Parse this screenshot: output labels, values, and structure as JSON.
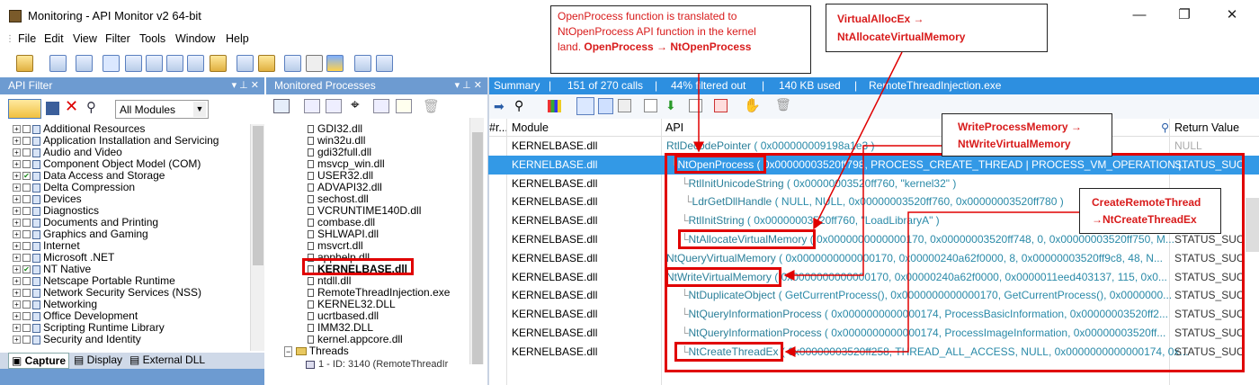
{
  "window": {
    "title": "Monitoring - API Monitor v2 64-bit",
    "minimize": "—",
    "maximize": "❐",
    "close": "✕"
  },
  "menu": [
    "File",
    "Edit",
    "View",
    "Filter",
    "Tools",
    "Window",
    "Help"
  ],
  "api_filter": {
    "title": "API Filter",
    "pins": "▾ ⊥ ✕",
    "module_select": "All Modules",
    "categories": [
      {
        "label": "Additional Resources",
        "checked": false
      },
      {
        "label": "Application Installation and Servicing",
        "checked": false
      },
      {
        "label": "Audio and Video",
        "checked": false
      },
      {
        "label": "Component Object Model (COM)",
        "checked": false
      },
      {
        "label": "Data Access and Storage",
        "checked": true
      },
      {
        "label": "Delta Compression",
        "checked": false
      },
      {
        "label": "Devices",
        "checked": false
      },
      {
        "label": "Diagnostics",
        "checked": false
      },
      {
        "label": "Documents and Printing",
        "checked": false
      },
      {
        "label": "Graphics and Gaming",
        "checked": false
      },
      {
        "label": "Internet",
        "checked": false
      },
      {
        "label": "Microsoft .NET",
        "checked": false
      },
      {
        "label": "NT Native",
        "checked": true
      },
      {
        "label": "Netscape Portable Runtime",
        "checked": false
      },
      {
        "label": "Network Security Services (NSS)",
        "checked": false
      },
      {
        "label": "Networking",
        "checked": false
      },
      {
        "label": "Office Development",
        "checked": false
      },
      {
        "label": "Scripting Runtime Library",
        "checked": false
      },
      {
        "label": "Security and Identity",
        "checked": false
      }
    ],
    "tabs": [
      "Capture",
      "Display",
      "External DLL"
    ]
  },
  "monitored_processes": {
    "title": "Monitored Processes",
    "pins": "▾ ⊥ ✕",
    "modules": [
      "GDI32.dll",
      "win32u.dll",
      "gdi32full.dll",
      "msvcp_win.dll",
      "USER32.dll",
      "ADVAPI32.dll",
      "sechost.dll",
      "VCRUNTIME140D.dll",
      "combase.dll",
      "SHLWAPI.dll",
      "msvcrt.dll",
      "apphelp.dll",
      "KERNELBASE.dll",
      "ntdll.dll",
      "RemoteThreadInjection.exe",
      "KERNEL32.DLL",
      "ucrtbased.dll",
      "IMM32.DLL",
      "kernel.appcore.dll"
    ],
    "threads_label": "Threads",
    "thread_item": "1 - ID: 3140 (RemoteThreadIr"
  },
  "summary": {
    "label": "Summary",
    "calls": "151 of 270 calls",
    "filtered": "44% filtered out",
    "used": "140 KB used",
    "process": "RemoteThreadInjection.exe"
  },
  "grid": {
    "headers": {
      "num": "#r...",
      "module": "Module",
      "api": "API",
      "ret": "Return Value"
    },
    "rows": [
      {
        "module": "KERNELBASE.dll",
        "fn": "RtlDecodePointer",
        "args": " ( 0x000000009198a1e3 )",
        "ret": "NULL"
      },
      {
        "module": "KERNELBASE.dll",
        "fn": "NtOpenProcess",
        "args": " ( 0x00000003520ff798, PROCESS_CREATE_THREAD | PROCESS_VM_OPERATION |...",
        "ret": "STATUS_SUC",
        "selected": true
      },
      {
        "module": "KERNELBASE.dll",
        "fn": "RtlInitUnicodeString",
        "args": " ( 0x00000003520ff760, \"kernel32\" )",
        "ret": ""
      },
      {
        "module": "KERNELBASE.dll",
        "fn": "LdrGetDllHandle",
        "args": " ( NULL, NULL, 0x00000003520ff760, 0x00000003520ff780 )",
        "ret": ""
      },
      {
        "module": "KERNELBASE.dll",
        "fn": "RtlInitString",
        "args": " ( 0x00000003520ff760, \"LoadLibraryA\" )",
        "ret": ""
      },
      {
        "module": "KERNELBASE.dll",
        "fn": "NtAllocateVirtualMemory",
        "args": " ( 0x0000000000000170, 0x00000003520ff748, 0, 0x00000003520ff750, M...",
        "ret": "STATUS_SUC"
      },
      {
        "module": "KERNELBASE.dll",
        "fn": "NtQueryVirtualMemory",
        "args": " ( 0x0000000000000170, 0x00000240a62f0000, 8, 0x00000003520ff9c8, 48, N...",
        "ret": "STATUS_SUC"
      },
      {
        "module": "KERNELBASE.dll",
        "fn": "NtWriteVirtualMemory",
        "args": " ( 0x0000000000000170, 0x00000240a62f0000, 0x0000011eed403137, 115, 0x0...",
        "ret": "STATUS_SUC"
      },
      {
        "module": "KERNELBASE.dll",
        "fn": "NtDuplicateObject",
        "args": " ( GetCurrentProcess(), 0x0000000000000170, GetCurrentProcess(), 0x0000000...",
        "ret": "STATUS_SUC"
      },
      {
        "module": "KERNELBASE.dll",
        "fn": "NtQueryInformationProcess",
        "args": " ( 0x0000000000000174, ProcessBasicInformation, 0x00000003520ff2...",
        "ret": "STATUS_SUC"
      },
      {
        "module": "KERNELBASE.dll",
        "fn": "NtQueryInformationProcess",
        "args": " ( 0x0000000000000174, ProcessImageInformation, 0x00000003520ff...",
        "ret": "STATUS_SUC"
      },
      {
        "module": "KERNELBASE.dll",
        "fn": "NtCreateThreadEx",
        "args": " ( 0x00000003520ff258, THREAD_ALL_ACCESS, NULL, 0x0000000000000174, 0x...",
        "ret": "STATUS_SUC"
      }
    ]
  },
  "annotations": {
    "openprocess": {
      "line1": "OpenProcess function is translated to",
      "line2": "NtOpenProcess API function in the kernel",
      "line3a": "land. ",
      "line3b": "OpenProcess → NtOpenProcess"
    },
    "virtualalloc": {
      "line1": "VirtualAllocEx →",
      "line2": "NtAllocateVirtualMemory"
    },
    "writeprocess": {
      "line1": "WriteProcessMemory →",
      "line2": "NtWriteVirtualMemory"
    },
    "createremote": {
      "line1": "CreateRemoteThread",
      "line2": "→NtCreateThreadEx"
    }
  }
}
